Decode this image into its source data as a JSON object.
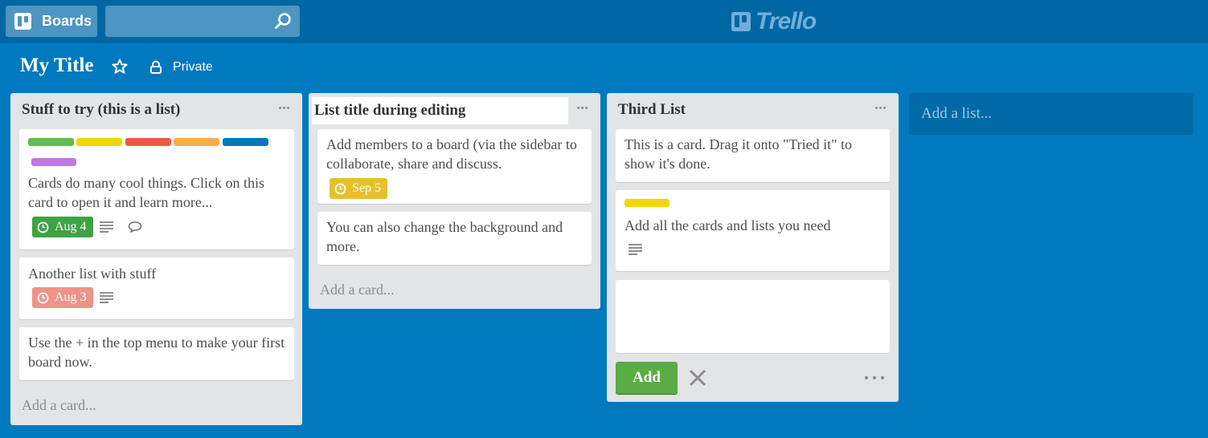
{
  "header": {
    "boards_label": "Boards",
    "search_placeholder": "",
    "logo_text": "Trello"
  },
  "board": {
    "title": "My Title",
    "privacy": "Private"
  },
  "lists": [
    {
      "title": "Stuff to try (this is a list)",
      "add_card": "Add a card...",
      "cards": [
        {
          "labels": [
            "#61bd4f",
            "#f2d600",
            "#eb5a46",
            "#ffab4a",
            "#0079bf",
            "#c377e0"
          ],
          "text": "Cards do many cool things. Click on this card to open it and learn more...",
          "due": "Aug 4",
          "due_color": "#3ea244"
        },
        {
          "text": "Another list with stuff",
          "due": "Aug 3",
          "due_color": "#ec9488"
        },
        {
          "text": "Use the + in the top menu to make your first board now."
        }
      ]
    },
    {
      "title": "List title during editing",
      "add_card": "Add a card...",
      "cards": [
        {
          "text": "Add members to a board (via the sidebar to collaborate, share and discuss.",
          "due": "Sep 5",
          "due_color": "#e6c02d"
        },
        {
          "text": "You can also change the background and more."
        }
      ]
    },
    {
      "title": "Third List",
      "cards": [
        {
          "text": "This is a card. Drag it onto \"Tried it\" to show it's done."
        },
        {
          "labels": [
            "#f2d600"
          ],
          "text": "Add all the cards and lists you need"
        }
      ],
      "composer": {
        "value": "",
        "add_label": "Add"
      }
    }
  ],
  "add_list": "Add a list..."
}
